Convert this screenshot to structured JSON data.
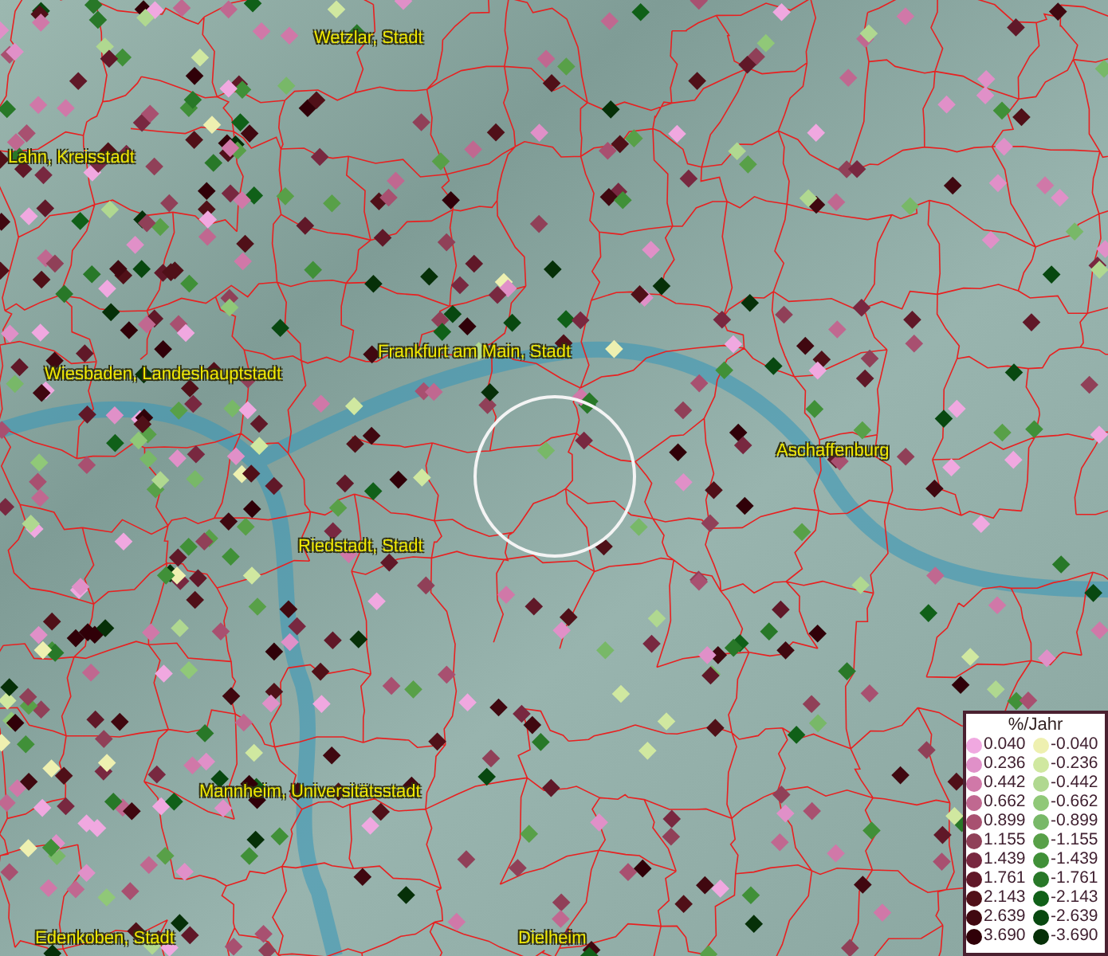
{
  "map": {
    "place_labels": [
      {
        "text": "Wetzlar, Stadt"
      },
      {
        "text": "Lahn, Kreisstadt"
      },
      {
        "text": "Frankfurt am Main, Stadt"
      },
      {
        "text": "Wiesbaden, Landeshauptstadt"
      },
      {
        "text": "Aschaffenburg"
      },
      {
        "text": "Riedstadt, Stadt"
      },
      {
        "text": "Mannheim, Universitätsstadt"
      },
      {
        "text": "Edenkoben, Stadt"
      },
      {
        "text": "Dielheim"
      }
    ]
  },
  "legend": {
    "title": "%/Jahr",
    "rows": [
      {
        "left": {
          "value": "0.040",
          "color": "#f0a8e0"
        },
        "right": {
          "value": "-0.040",
          "color": "#eef0b0"
        }
      },
      {
        "left": {
          "value": "0.236",
          "color": "#e090c8"
        },
        "right": {
          "value": "-0.236",
          "color": "#d0e8a0"
        }
      },
      {
        "left": {
          "value": "0.442",
          "color": "#d078a8"
        },
        "right": {
          "value": "-0.442",
          "color": "#b0d890"
        }
      },
      {
        "left": {
          "value": "0.662",
          "color": "#c06890"
        },
        "right": {
          "value": "-0.662",
          "color": "#90c878"
        }
      },
      {
        "left": {
          "value": "0.899",
          "color": "#a85070"
        },
        "right": {
          "value": "-0.899",
          "color": "#78b868"
        }
      },
      {
        "left": {
          "value": "1.155",
          "color": "#904058"
        },
        "right": {
          "value": "-1.155",
          "color": "#58a048"
        }
      },
      {
        "left": {
          "value": "1.439",
          "color": "#782840"
        },
        "right": {
          "value": "-1.439",
          "color": "#409038"
        }
      },
      {
        "left": {
          "value": "1.761",
          "color": "#601828"
        },
        "right": {
          "value": "-1.761",
          "color": "#287828"
        }
      },
      {
        "left": {
          "value": "2.143",
          "color": "#501018"
        },
        "right": {
          "value": "-2.143",
          "color": "#106018"
        }
      },
      {
        "left": {
          "value": "2.639",
          "color": "#400810"
        },
        "right": {
          "value": "-2.639",
          "color": "#084810"
        }
      },
      {
        "left": {
          "value": "3.690",
          "color": "#300008"
        },
        "right": {
          "value": "-3.690",
          "color": "#063008"
        }
      }
    ]
  }
}
